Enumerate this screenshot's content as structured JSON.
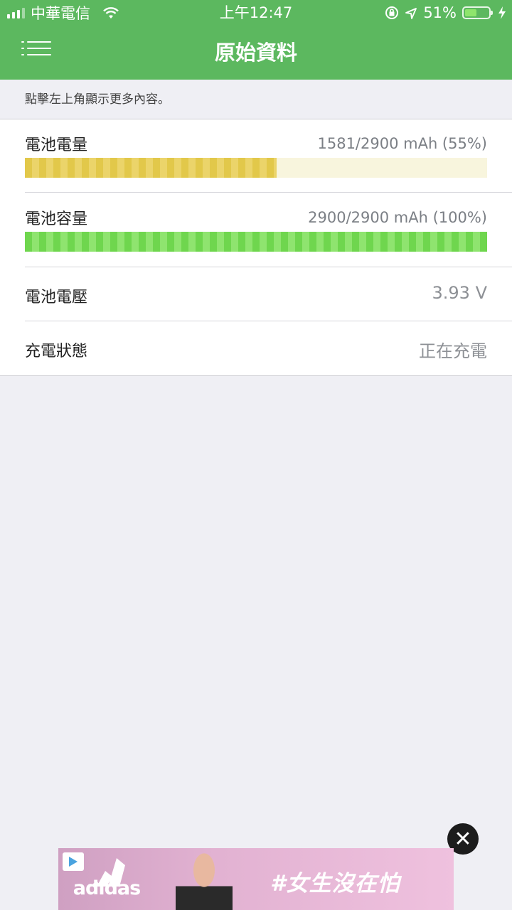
{
  "status_bar": {
    "carrier": "中華電信",
    "time": "上午12:47",
    "battery_percent": "51%",
    "battery_level": 0.51,
    "icons": [
      "signal-icon",
      "wifi-icon",
      "orientation-lock-icon",
      "location-arrow-icon",
      "battery-icon",
      "charging-bolt-icon"
    ]
  },
  "nav": {
    "title": "原始資料",
    "menu_icon": "menu-icon"
  },
  "hint": "點擊左上角顯示更多內容。",
  "rows": {
    "charge": {
      "label": "電池電量",
      "value": "1581/2900 mAh (55%)",
      "fraction": 0.545,
      "color": "#e2c84a"
    },
    "capacity": {
      "label": "電池容量",
      "value": "2900/2900 mAh (100%)",
      "fraction": 1.0,
      "color": "#6fd64e"
    },
    "voltage": {
      "label": "電池電壓",
      "value": "3.93 V"
    },
    "charging_state": {
      "label": "充電狀態",
      "value": "正在充電"
    }
  },
  "ad": {
    "close_symbol": "✕",
    "brand": "adidas",
    "slogan": "#女生沒在怕"
  },
  "colors": {
    "accent": "#5cb85f",
    "background": "#efeff4"
  }
}
